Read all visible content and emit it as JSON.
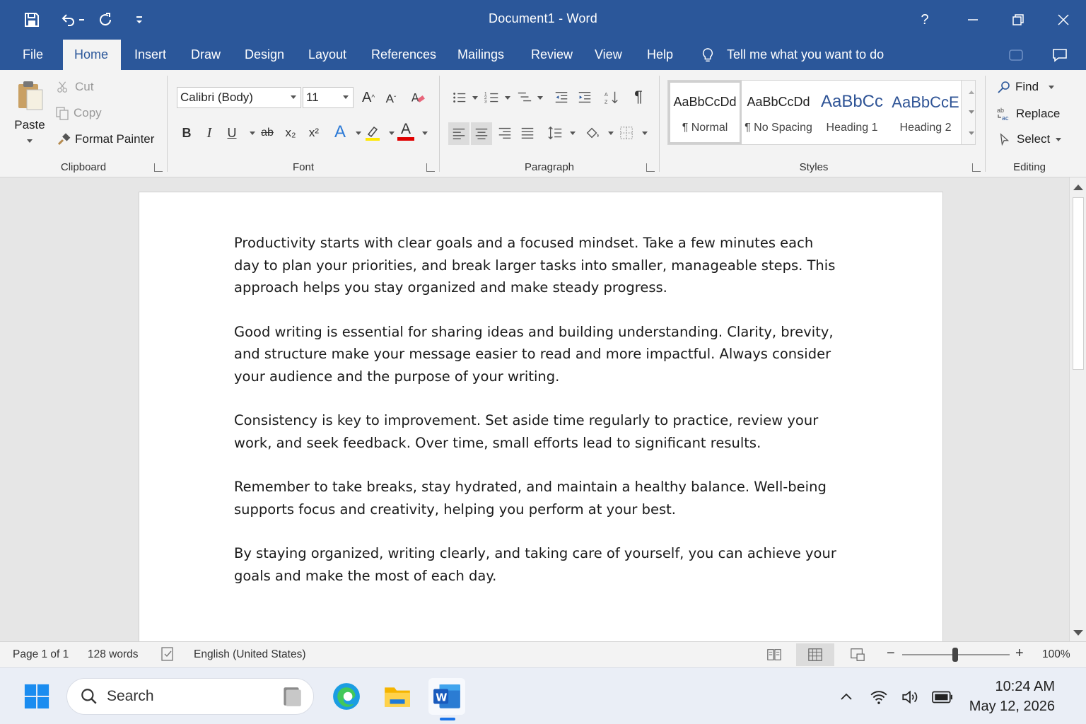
{
  "window": {
    "title": "Document1  -  Word",
    "help": "?"
  },
  "tabs": [
    "File",
    "Home",
    "Insert",
    "Draw",
    "Design",
    "Layout",
    "References",
    "Mailings",
    "Review",
    "View",
    "Help"
  ],
  "active_tab": "Home",
  "tell_me": "Tell me what you want to do",
  "clipboard": {
    "paste": "Paste",
    "cut": "Cut",
    "copy": "Copy",
    "format_painter": "Format Painter",
    "label": "Clipboard"
  },
  "font": {
    "family": "Calibri (Body)",
    "size": "11",
    "label": "Font",
    "bold": "B",
    "italic": "I",
    "underline": "U",
    "strikethrough": "ab",
    "subscript": "x₂",
    "superscript": "x²",
    "grow": "A",
    "shrink": "A",
    "font_color_letter": "A",
    "effects_letter": "A",
    "font_color": "#e00000",
    "highlight_color": "#ffe800"
  },
  "paragraph": {
    "label": "Paragraph",
    "pilcrow": "¶"
  },
  "styles": {
    "label": "Styles",
    "items": [
      {
        "preview": "AaBbCcDd",
        "name": "¶ Normal"
      },
      {
        "preview": "AaBbCcDd",
        "name": "¶ No Spacing"
      },
      {
        "preview": "AaBbCc",
        "name": "Heading 1"
      },
      {
        "preview": "AaBbCcE",
        "name": "Heading 2"
      }
    ],
    "heading_color": "#2f5496"
  },
  "editing": {
    "label": "Editing",
    "find": "Find",
    "replace": "Replace",
    "select": "Select"
  },
  "document": {
    "paragraphs": [
      "Productivity starts with clear goals and a focused mindset. Take a few minutes each day to plan your priorities, and break larger tasks into smaller, manageable steps. This approach helps you stay organized and make steady progress.",
      "Good writing is essential for sharing ideas and building understanding. Clarity, brevity, and structure make your message easier to read and more impactful. Always consider your audience and the purpose of your writing.",
      "Consistency is key to improvement. Set aside time regularly to practice, review your work, and seek feedback. Over time, small efforts lead to significant results.",
      "Remember to take breaks, stay hydrated, and maintain a healthy balance. Well-being supports focus and creativity, helping you perform at your best.",
      "By staying organized, writing clearly, and taking care of yourself, you can achieve your goals and make the most of each day."
    ]
  },
  "status": {
    "page": "Page 1 of 1",
    "words": "128 words",
    "language": "English (United States)",
    "zoom": "100%",
    "zoom_minus": "−",
    "zoom_plus": "+"
  },
  "taskbar": {
    "search": "Search",
    "time": "10:24 AM",
    "date": "May 12, 2026"
  },
  "colors": {
    "word_blue": "#2b579a",
    "ribbon_bg": "#f3f3f3"
  }
}
